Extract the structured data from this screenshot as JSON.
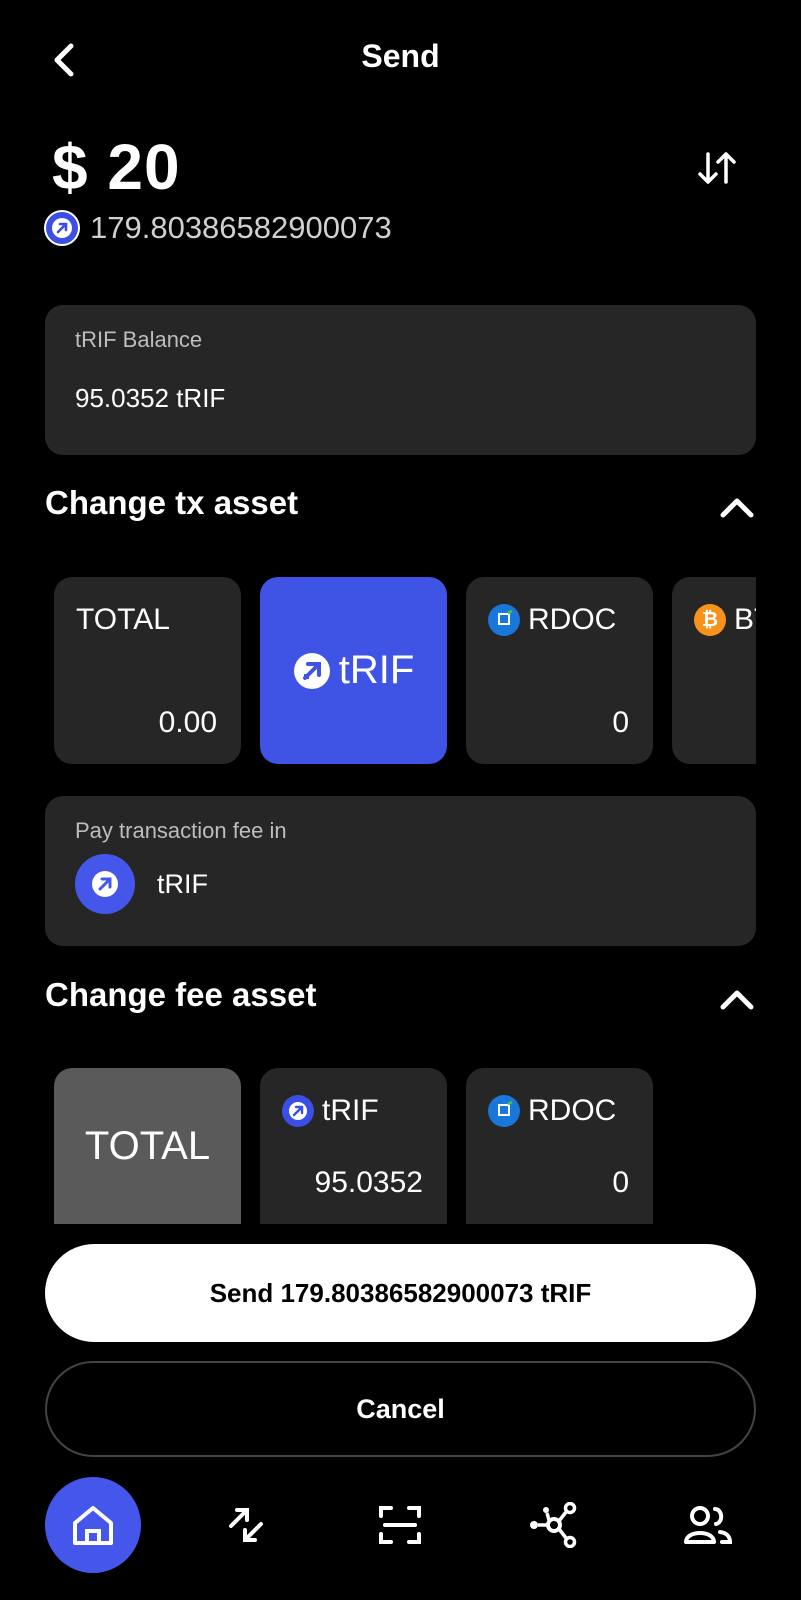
{
  "header": {
    "title": "Send"
  },
  "amount": {
    "fiat": "$ 20",
    "token_amount": "179.80386582900073"
  },
  "balance": {
    "label": "tRIF Balance",
    "value": "95.0352 tRIF"
  },
  "tx_asset": {
    "title": "Change tx asset",
    "tiles": [
      {
        "label": "TOTAL",
        "value": "0.00",
        "icon": "none"
      },
      {
        "label": "tRIF",
        "value": "",
        "icon": "trif-icon",
        "selected": true
      },
      {
        "label": "RDOC",
        "value": "0",
        "icon": "rdoc-icon"
      },
      {
        "label": "BTC",
        "value": "",
        "icon": "bitcoin-icon"
      }
    ]
  },
  "fee": {
    "label": "Pay transaction fee in",
    "token": "tRIF"
  },
  "fee_asset": {
    "title": "Change fee asset",
    "tiles": [
      {
        "label": "TOTAL",
        "value": "",
        "icon": "none",
        "selected": true
      },
      {
        "label": "tRIF",
        "value": "95.0352",
        "icon": "trif-icon"
      },
      {
        "label": "RDOC",
        "value": "0",
        "icon": "rdoc-icon"
      }
    ]
  },
  "actions": {
    "send_label": "Send 179.80386582900073 tRIF",
    "cancel_label": "Cancel"
  },
  "nav": [
    "home-icon",
    "transactions-icon",
    "scan-icon",
    "dapps-icon",
    "contacts-icon"
  ],
  "colors": {
    "accent": "#4557ea",
    "card": "#262626",
    "background": "#000000"
  }
}
